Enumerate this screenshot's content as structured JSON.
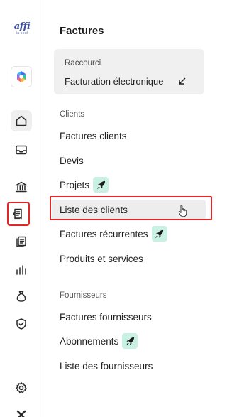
{
  "brand": {
    "logo_text": "affi",
    "logo_sub": "ia soul"
  },
  "rail": {
    "items": [
      {
        "icon": "home-icon"
      },
      {
        "icon": "inbox-icon"
      },
      {
        "icon": "bank-icon"
      },
      {
        "icon": "invoice-icon"
      },
      {
        "icon": "documents-icon"
      },
      {
        "icon": "bar-chart-icon"
      },
      {
        "icon": "money-bag-icon"
      },
      {
        "icon": "shield-check-icon"
      },
      {
        "icon": "gear-icon"
      }
    ]
  },
  "panel": {
    "title": "Factures",
    "shortcut": {
      "label": "Raccourci",
      "link": "Facturation électronique"
    },
    "sections": [
      {
        "label": "Clients",
        "items": [
          {
            "label": "Factures clients",
            "badge": false
          },
          {
            "label": "Devis",
            "badge": false
          },
          {
            "label": "Projets",
            "badge": true
          },
          {
            "label": "Liste des clients",
            "badge": false,
            "selected": true
          },
          {
            "label": "Factures récurrentes",
            "badge": true
          },
          {
            "label": "Produits et services",
            "badge": false
          }
        ]
      },
      {
        "label": "Fournisseurs",
        "items": [
          {
            "label": "Factures fournisseurs",
            "badge": false
          },
          {
            "label": "Abonnements",
            "badge": true
          },
          {
            "label": "Liste des fournisseurs",
            "badge": false
          }
        ]
      }
    ]
  },
  "colors": {
    "highlight_outline": "#e22626",
    "badge_bg": "#c9f1e3",
    "selected_bg": "#ededed",
    "shortcut_bg": "#f0f0f0"
  }
}
